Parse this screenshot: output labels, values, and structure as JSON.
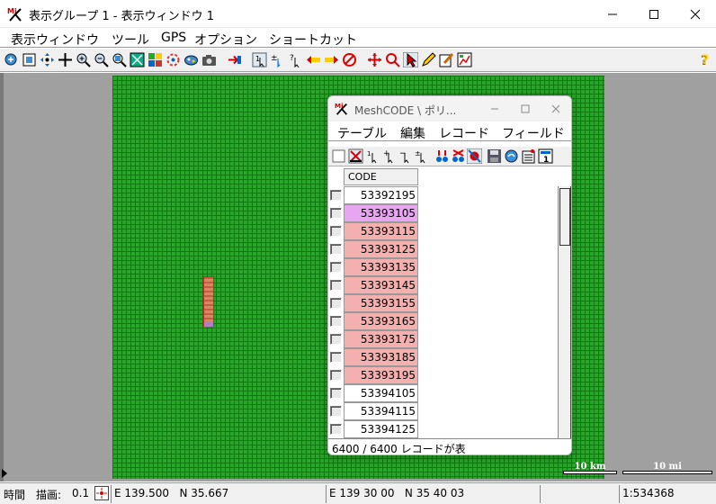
{
  "window": {
    "title": "表示グループ 1 - 表示ウィンドウ 1"
  },
  "menu": [
    "表示ウィンドウ",
    "ツール",
    "GPS",
    "オプション",
    "ショートカット"
  ],
  "toolbar": {
    "icons": [
      "zoom-all-icon",
      "zoom-box-icon",
      "pan-arrows-icon",
      "zoom-in-icon",
      "zoom-out-icon",
      "zoom-window-icon",
      "zoom-fit-icon",
      "layers-icon",
      "refresh-icon",
      "layer-control-icon",
      "camera-icon",
      "add-layer-icon",
      "select-icon",
      "plus-minus-icon",
      "query-icon",
      "arrows-left-icon",
      "arrows-right-icon",
      "stop-icon",
      "move-cross-icon",
      "magnify-icon",
      "pointer-icon",
      "pencil-icon",
      "edit-icon",
      "chart-icon",
      "help-icon"
    ]
  },
  "map": {
    "scalebars": [
      "10 km",
      "10 mi"
    ]
  },
  "subwindow": {
    "title": "MeshCODE \\ ポリ...",
    "menu": [
      "テーブル",
      "編集",
      "レコード",
      "フィールド"
    ],
    "column_header": "CODE",
    "rows": [
      {
        "value": "53392195",
        "state": "normal"
      },
      {
        "value": "53393105",
        "state": "active"
      },
      {
        "value": "53393115",
        "state": "selected"
      },
      {
        "value": "53393125",
        "state": "selected"
      },
      {
        "value": "53393135",
        "state": "selected"
      },
      {
        "value": "53393145",
        "state": "selected"
      },
      {
        "value": "53393155",
        "state": "selected"
      },
      {
        "value": "53393165",
        "state": "selected"
      },
      {
        "value": "53393175",
        "state": "selected"
      },
      {
        "value": "53393185",
        "state": "selected"
      },
      {
        "value": "53393195",
        "state": "selected"
      },
      {
        "value": "53394105",
        "state": "normal"
      },
      {
        "value": "53394115",
        "state": "normal"
      },
      {
        "value": "53394125",
        "state": "normal"
      }
    ],
    "status": "6400 / 6400 レコードが表",
    "colors": {
      "selected": "#f4b0ae",
      "active": "#e8a6f0",
      "normal": "#ffffff"
    }
  },
  "statusbar": {
    "time_label": "時間",
    "draw_label": "描画:",
    "draw_value": "0.1",
    "coords1": "E 139.500   N 35.667",
    "coords2": "E 139 30 00   N 35 40 03",
    "scale": "1:534368"
  },
  "colors": {
    "map_fill": "#2aa42a",
    "map_grid": "#0d7a0d",
    "background": "#a0a0a0"
  }
}
